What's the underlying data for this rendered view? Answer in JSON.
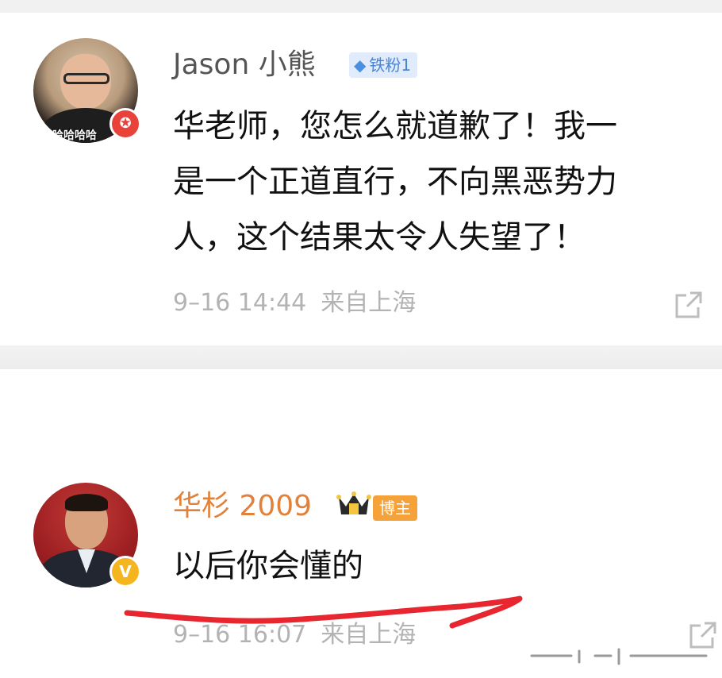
{
  "comments": [
    {
      "username": "Jason 小熊",
      "fan_badge": "铁粉1",
      "avatar_caption": "哈哈哈哈",
      "lines": [
        "华老师，您怎么就道歉了！我一",
        "是一个正道直行，不向黑恶势力",
        "人，这个结果太令人失望了！"
      ],
      "time": "9–16 14:44",
      "location": "来自上海"
    },
    {
      "username": "华杉 2009",
      "host_badge": "博主",
      "lines": [
        "以后你会懂的"
      ],
      "time": "9–16 16:07",
      "location": "来自上海"
    }
  ],
  "icons": {
    "verified_red": "star-badge-icon",
    "verified_gold": "v-badge-icon",
    "fan_badge": "diamond-icon",
    "host": "crown-icon",
    "share": "share-icon"
  },
  "colors": {
    "username_normal": "#555555",
    "username_host": "#e2813a",
    "meta": "#b3b3b3",
    "fan_badge_bg": "#e0ebfb",
    "host_badge_bg": "#f5a23a",
    "annotation_red": "#e8262f"
  }
}
